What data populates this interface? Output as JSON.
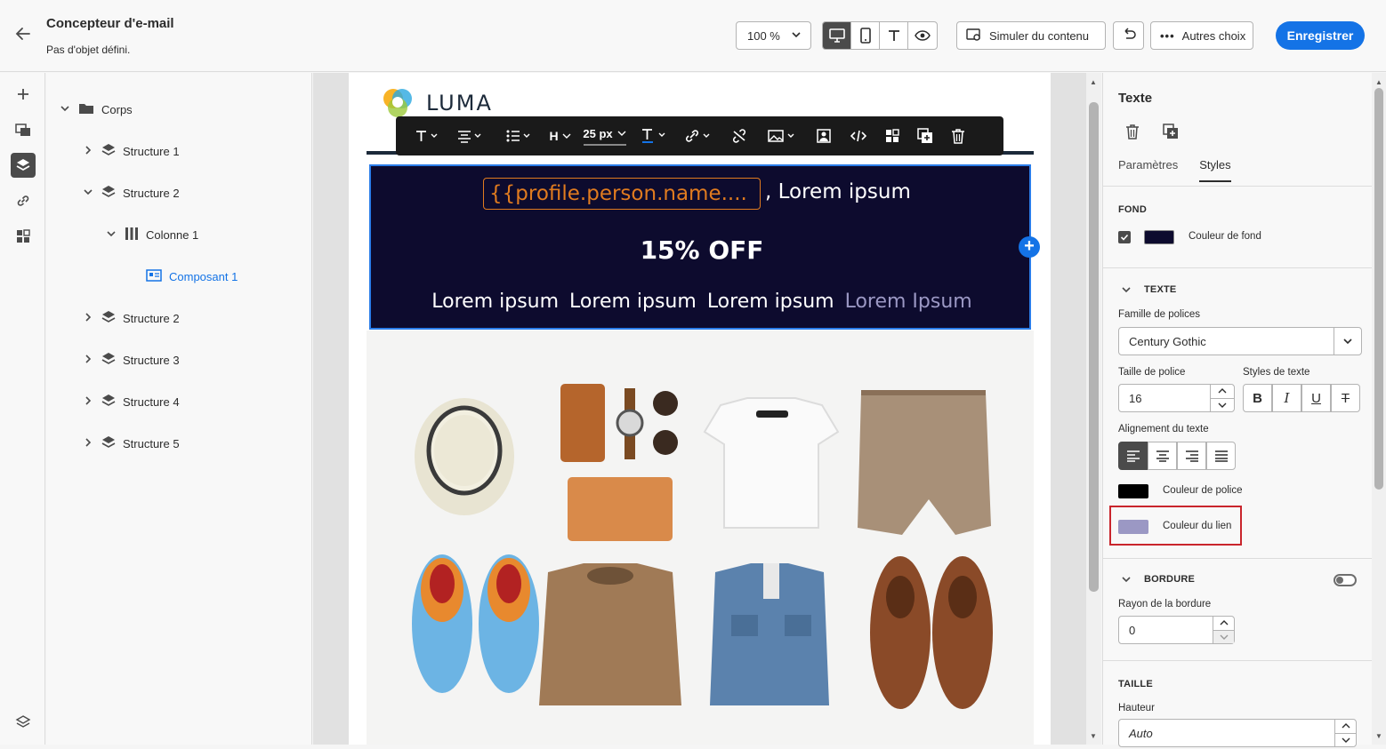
{
  "header": {
    "back_icon": "arrow-left-icon",
    "title": "Concepteur d'e-mail",
    "subtitle": "Pas d'objet défini.",
    "zoom_value": "100 %",
    "simulate_label": "Simuler du contenu",
    "more_label": "Autres choix",
    "save_label": "Enregistrer"
  },
  "tree": {
    "root": "Corps",
    "items": [
      {
        "label": "Structure 1"
      },
      {
        "label": "Structure 2"
      },
      {
        "label": "Colonne 1"
      },
      {
        "label": "Composant 1"
      },
      {
        "label": "Structure 2"
      },
      {
        "label": "Structure 3"
      },
      {
        "label": "Structure 4"
      },
      {
        "label": "Structure 5"
      }
    ]
  },
  "email": {
    "logo_text": "LUMA",
    "font_size": "25 px",
    "personalization": "{{profile.person.name....",
    "greeting": ", Lorem ipsum",
    "offer": "15% OFF",
    "links": [
      "Lorem ipsum",
      "Lorem ipsum",
      "Lorem ipsum",
      "Lorem Ipsum"
    ]
  },
  "panel": {
    "title": "Texte",
    "tab_params": "Paramètres",
    "tab_styles": "Styles",
    "bg_section": "FOND",
    "bg_label": "Couleur de fond",
    "text_section": "TEXTE",
    "font_family_label": "Famille de polices",
    "font_family_value": "Century Gothic",
    "font_size_label": "Taille de police",
    "font_size_value": "16",
    "text_styles_label": "Styles de texte",
    "align_label": "Alignement du texte",
    "font_color_label": "Couleur de police",
    "link_color_label": "Couleur du lien",
    "border_section": "BORDURE",
    "radius_label": "Rayon de la bordure",
    "radius_value": "0",
    "size_section": "TAILLE",
    "height_label": "Hauteur",
    "height_value": "Auto"
  },
  "colors": {
    "accent": "#1473e6",
    "banner_bg": "#0d0b2e",
    "font_color": "#000000",
    "link_color": "#9b98c4",
    "highlight_border": "#c9252c"
  }
}
